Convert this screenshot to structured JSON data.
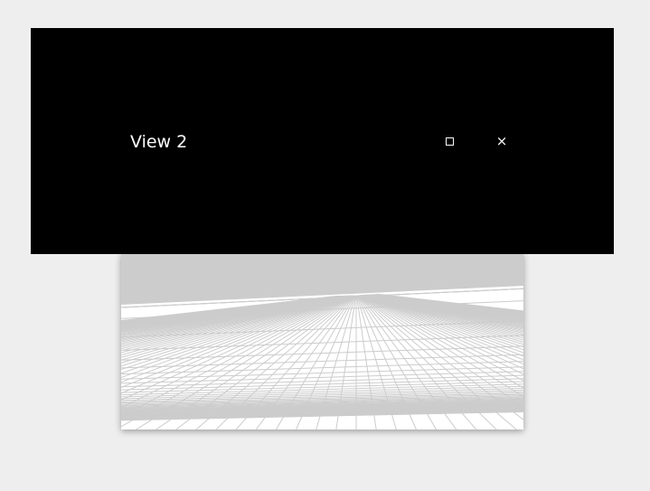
{
  "window": {
    "title": "View 2",
    "buttons": {
      "maximize": {
        "icon": "maximize-icon",
        "glyph": "□"
      },
      "close": {
        "icon": "close-icon",
        "glyph": "×"
      }
    },
    "titlebar_color": "#000000",
    "title_color": "#ffffff"
  },
  "scene": {
    "sky_color": "#cccccc",
    "ground_color": "#ffffff",
    "grid_line_color": "#cccccc",
    "page_background": "#eeeeee"
  }
}
